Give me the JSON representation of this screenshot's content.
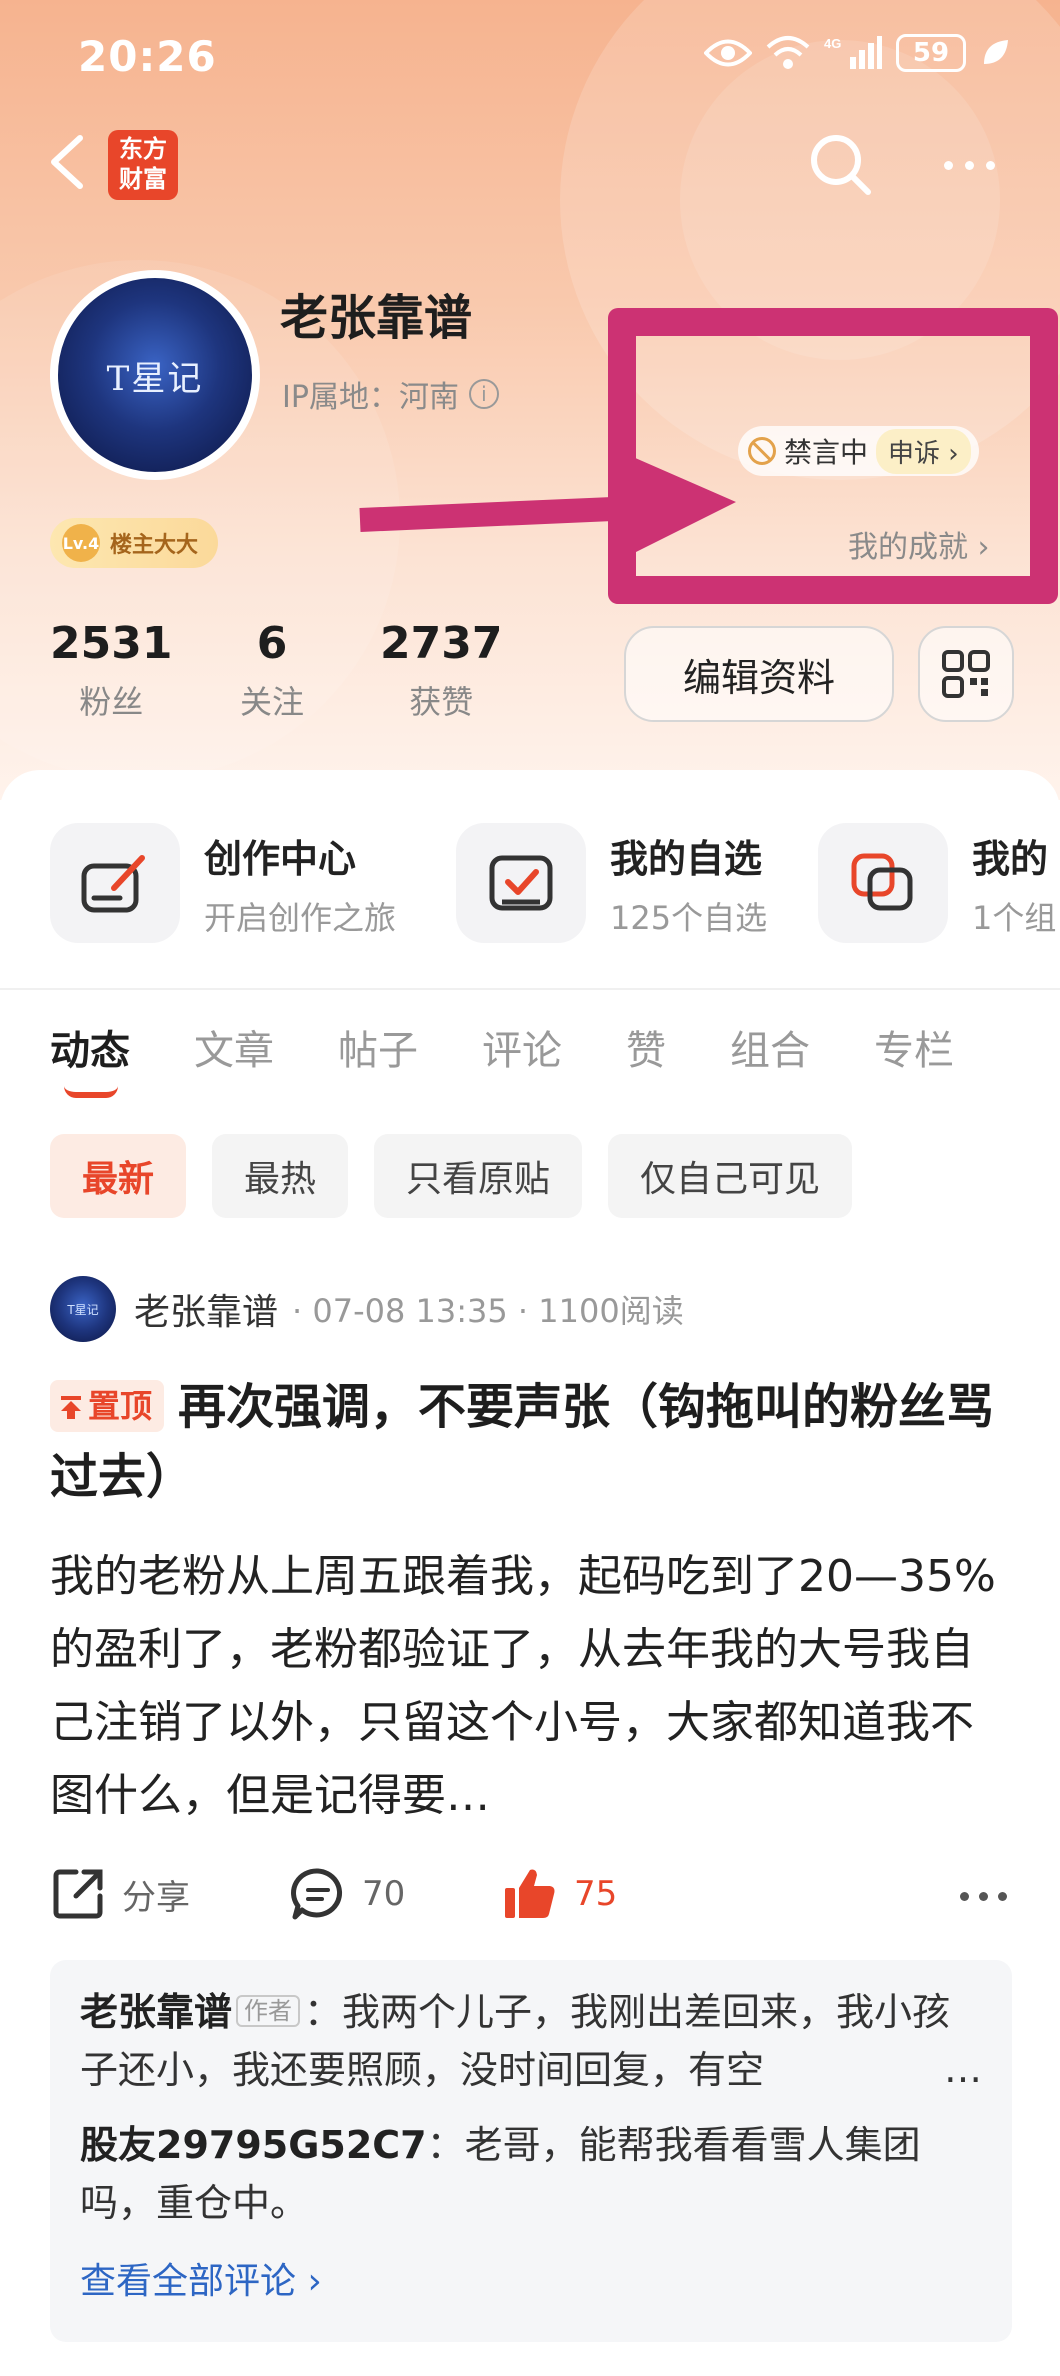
{
  "status_bar": {
    "time": "20:26",
    "battery": "59",
    "network": "4G"
  },
  "nav": {
    "logo_line1": "东方",
    "logo_line2": "财富"
  },
  "profile": {
    "avatar_text": "T星记",
    "username": "老张靠谱",
    "ip_location": "IP属地：河南",
    "level_badge_icon": "Lv.4",
    "level_badge": "楼主大大",
    "ban_status": "禁言中",
    "appeal": "申诉 ›",
    "achievements": "我的成就 ›"
  },
  "stats": [
    {
      "value": "2531",
      "label": "粉丝"
    },
    {
      "value": "6",
      "label": "关注"
    },
    {
      "value": "2737",
      "label": "获赞"
    }
  ],
  "buttons": {
    "edit_profile": "编辑资料"
  },
  "quick_links": [
    {
      "title": "创作中心",
      "subtitle": "开启创作之旅",
      "icon": "pen-icon"
    },
    {
      "title": "我的自选",
      "subtitle": "125个自选",
      "icon": "checklist-icon"
    },
    {
      "title": "我的",
      "subtitle": "1个组",
      "icon": "portfolio-icon"
    }
  ],
  "tabs": [
    "动态",
    "文章",
    "帖子",
    "评论",
    "赞",
    "组合",
    "专栏"
  ],
  "filters": [
    "最新",
    "最热",
    "只看原贴",
    "仅自己可见"
  ],
  "post": {
    "avatar_text": "T星记",
    "author": "老张靠谱",
    "meta": "· 07-08 13:35 · 1100阅读",
    "pin_label": "置顶",
    "title": "再次强调，不要声张（钩拖叫的粉丝骂过去）",
    "body": "我的老粉从上周五跟着我，起码吃到了20—35%的盈利了，老粉都验证了，从去年我的大号我自己注销了以外，只留这个小号，大家都知道我不图什么，但是记得要…",
    "share": "分享",
    "comments_count": "70",
    "likes_count": "75"
  },
  "comments": [
    {
      "name": "老张靠谱",
      "tag": "作者",
      "text": "：我两个儿子，我刚出差回来，我小孩子还小，我还要照顾，没时间回复，有空"
    },
    {
      "name": "股友29795G52C7",
      "text": "：老哥，能帮我看看雪人集团吗，重仓中。"
    }
  ],
  "comments_ellipsis": "…",
  "view_all_comments": "查看全部评论 ›",
  "colors": {
    "accent": "#e8462a",
    "highlight": "#cc3273",
    "link": "#2d66c4"
  }
}
